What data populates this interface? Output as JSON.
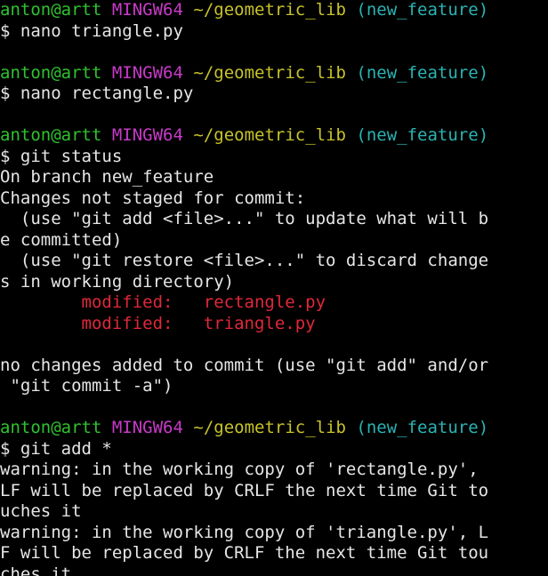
{
  "colors": {
    "background": "#000000",
    "user": "#2fc22f",
    "env": "#c83ac8",
    "path": "#c8c32a",
    "branch": "#2ab3b3",
    "modified": "#e0283a",
    "text": "#e6e6e6"
  },
  "prompt": {
    "user_host": "anton@artt",
    "env": "MINGW64",
    "path": "~/geometric_lib",
    "branch": "(new_feature)"
  },
  "blocks": [
    {
      "command": "$ nano triangle.py",
      "output": []
    },
    {
      "command": "$ nano rectangle.py",
      "output": []
    },
    {
      "command": "$ git status",
      "output": [
        {
          "text": "On branch new_feature"
        },
        {
          "text": "Changes not staged for commit:"
        },
        {
          "text": "  (use \"git add <file>...\" to update what will b"
        },
        {
          "text": "e committed)"
        },
        {
          "text": "  (use \"git restore <file>...\" to discard change"
        },
        {
          "text": "s in working directory)"
        },
        {
          "text": "        modified:   rectangle.py",
          "style": "modified"
        },
        {
          "text": "        modified:   triangle.py",
          "style": "modified"
        },
        {
          "text": ""
        },
        {
          "text": "no changes added to commit (use \"git add\" and/or"
        },
        {
          "text": " \"git commit -a\")"
        }
      ]
    },
    {
      "command": "$ git add *",
      "output": [
        {
          "text": "warning: in the working copy of 'rectangle.py',"
        },
        {
          "text": "LF will be replaced by CRLF the next time Git to"
        },
        {
          "text": "uches it"
        },
        {
          "text": "warning: in the working copy of 'triangle.py', L"
        },
        {
          "text": "F will be replaced by CRLF the next time Git tou"
        },
        {
          "text": "ches it"
        }
      ]
    }
  ]
}
